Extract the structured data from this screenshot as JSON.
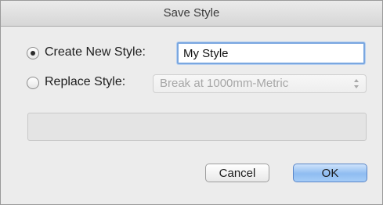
{
  "dialog": {
    "title": "Save Style",
    "options": {
      "create_new": {
        "label": "Create New Style:",
        "selected": true,
        "value": "My Style"
      },
      "replace": {
        "label": "Replace Style:",
        "selected": false,
        "selected_value": "Break at 1000mm-Metric"
      }
    },
    "buttons": {
      "cancel_label": "Cancel",
      "ok_label": "OK"
    }
  },
  "icons": {
    "radio": "radio-icon",
    "select_arrows": "up-down-arrows-icon"
  },
  "colors": {
    "accent_button": "#8fbcf1",
    "focus_ring": "#7aa7e0",
    "disabled_text": "#a6a6a6"
  }
}
